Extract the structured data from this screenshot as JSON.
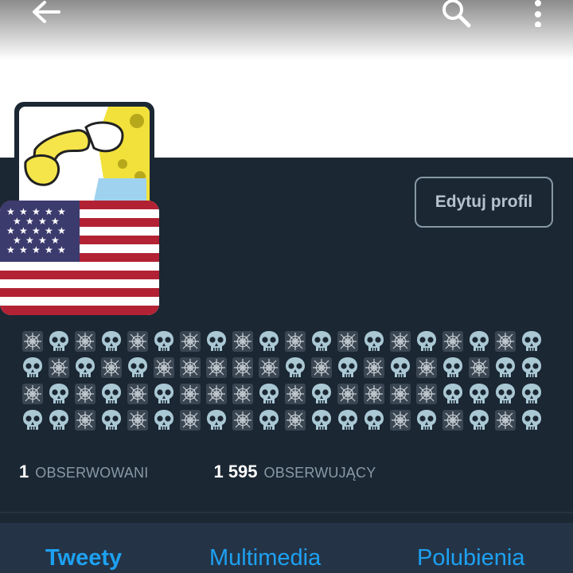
{
  "header": {
    "back_icon": "arrow-left-icon",
    "search_icon": "search-icon",
    "more_icon": "more-vertical-icon"
  },
  "profile": {
    "edit_button_label": "Edytuj profil",
    "avatar_description_icon": "avatar",
    "flag_icon": "us-flag-icon",
    "bio_emoji_rows": [
      [
        "web",
        "skull",
        "web",
        "skull",
        "web",
        "skull",
        "web",
        "skull",
        "web",
        "skull",
        "web",
        "skull",
        "web",
        "skull",
        "web",
        "skull",
        "web",
        "skull",
        "web",
        "skull"
      ],
      [
        "skull",
        "web",
        "skull",
        "web",
        "skull",
        "web",
        "web",
        "web",
        "web",
        "web",
        "skull",
        "web",
        "skull",
        "web",
        "skull",
        "web",
        "skull",
        "web",
        "skull",
        "skull"
      ],
      [
        "web",
        "skull",
        "web",
        "skull",
        "web",
        "skull",
        "web",
        "web",
        "web",
        "skull",
        "web",
        "skull",
        "web",
        "web",
        "web",
        "web",
        "skull",
        "skull",
        "skull",
        "skull"
      ],
      [
        "skull",
        "skull",
        "web",
        "skull",
        "web",
        "skull",
        "web",
        "skull",
        "web",
        "skull",
        "web",
        "skull",
        "skull",
        "skull",
        "web",
        "skull",
        "web",
        "skull",
        "web",
        "skull"
      ]
    ]
  },
  "stats": {
    "following_count": "1",
    "following_label": "OBSERWOWANI",
    "followers_count": "1 595",
    "followers_label": "OBSERWUJĄCY"
  },
  "tabs": [
    {
      "label": "Tweety",
      "active": true
    },
    {
      "label": "Multimedia",
      "active": false
    },
    {
      "label": "Polubienia",
      "active": false
    }
  ],
  "colors": {
    "background": "#1b2733",
    "accent": "#1da1f2",
    "muted": "#8899a6"
  }
}
